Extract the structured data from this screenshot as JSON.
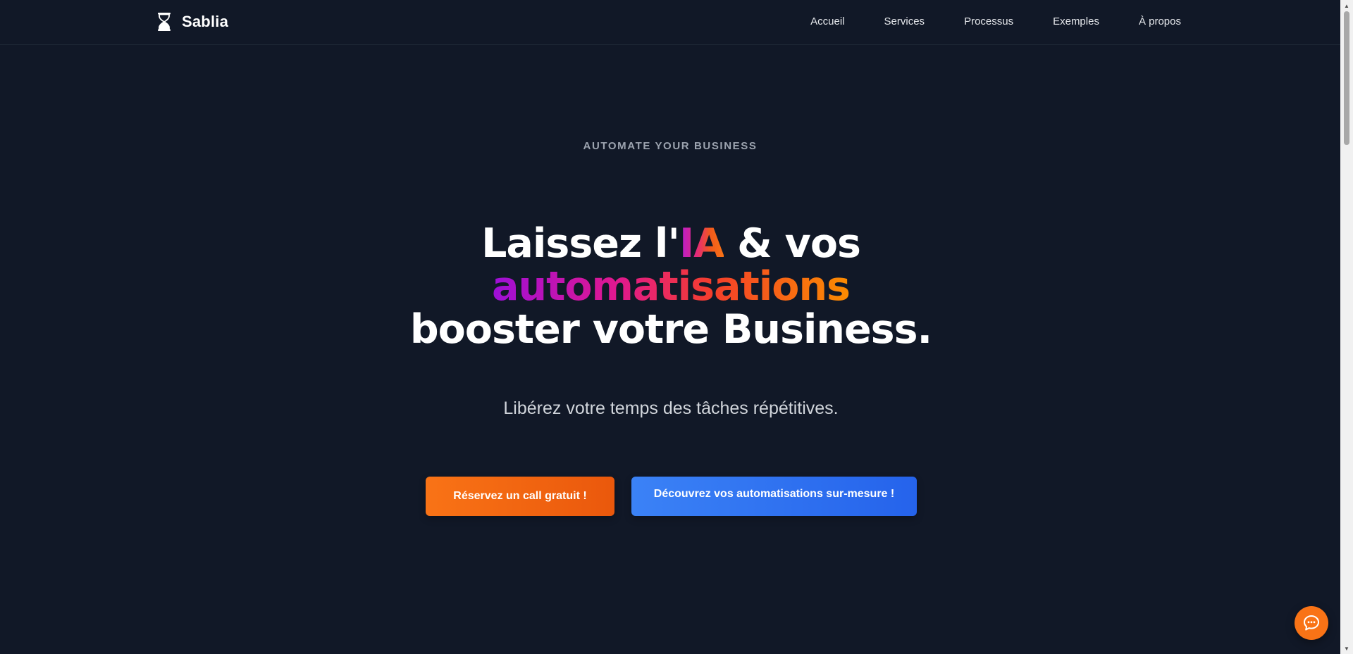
{
  "header": {
    "brand_name": "Sablia",
    "brand_icon": "hourglass-icon",
    "nav": [
      {
        "label": "Accueil"
      },
      {
        "label": "Services"
      },
      {
        "label": "Processus"
      },
      {
        "label": "Exemples"
      },
      {
        "label": "À propos"
      }
    ]
  },
  "hero": {
    "eyebrow": "AUTOMATE YOUR BUSINESS",
    "headline": {
      "part1": "Laissez l'",
      "highlight_ia": "IA",
      "part2": " & vos",
      "highlight_auto": "automatisations",
      "part3": "booster votre Business."
    },
    "subtitle": "Libérez votre temps des tâches répétitives.",
    "cta_primary": "Réservez un call gratuit !",
    "cta_secondary": "Découvrez vos automatisations sur-mesure !"
  },
  "chat": {
    "icon": "chat-bubble-icon"
  },
  "colors": {
    "background": "#111827",
    "primary_orange": "#f97316",
    "secondary_blue": "#3b82f6",
    "gradient_purple": "#9d0fd8",
    "gradient_pink": "#e1188f",
    "gradient_red": "#f43f2a"
  }
}
